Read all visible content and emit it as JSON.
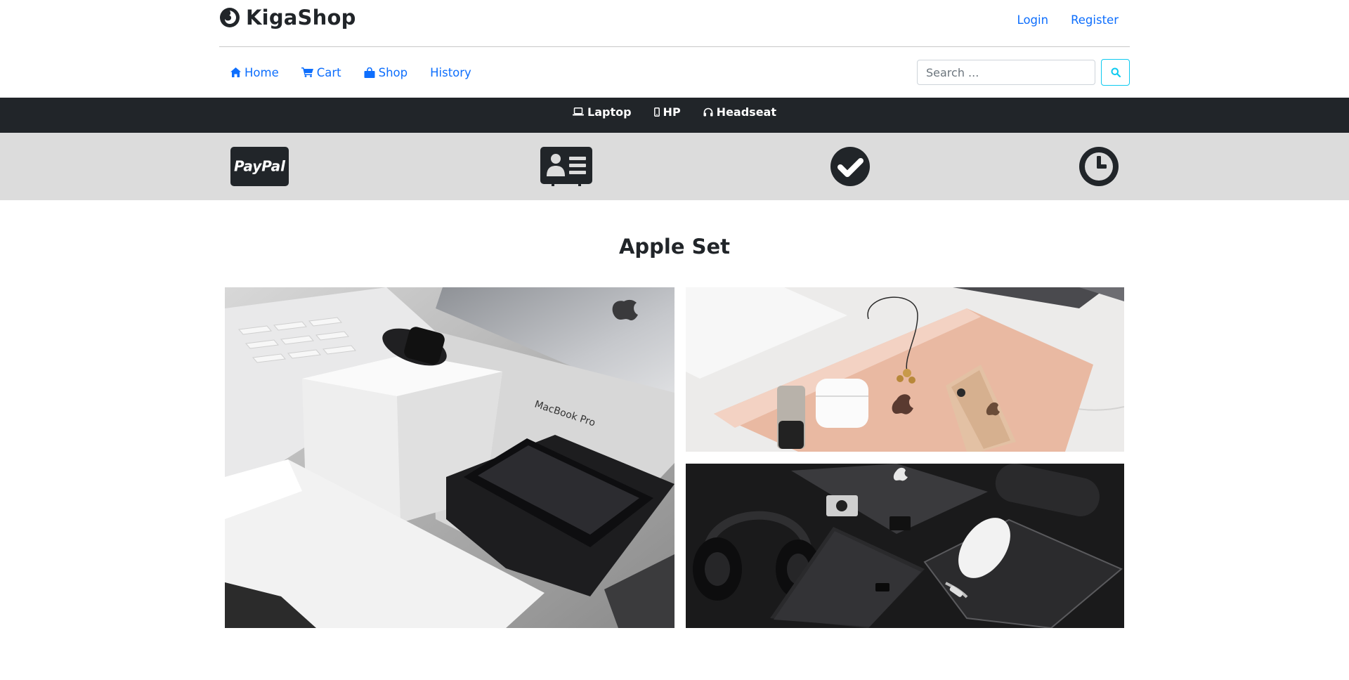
{
  "header": {
    "brand": "KigaShop",
    "login": "Login",
    "register": "Register"
  },
  "nav": {
    "items": [
      {
        "label": "Home",
        "icon": "home-icon"
      },
      {
        "label": "Cart",
        "icon": "cart-icon"
      },
      {
        "label": "Shop",
        "icon": "shopping-bag-icon"
      },
      {
        "label": "History",
        "icon": ""
      }
    ],
    "search_placeholder": "Search ...",
    "search_icon": "search-icon"
  },
  "categories": [
    {
      "label": "Laptop",
      "icon": "laptop-icon"
    },
    {
      "label": "HP",
      "icon": "mobile-icon"
    },
    {
      "label": "Headseat",
      "icon": "headphones-icon"
    }
  ],
  "features": [
    {
      "icon": "paypal-icon",
      "text": "PayPal"
    },
    {
      "icon": "id-card-icon"
    },
    {
      "icon": "check-circle-icon"
    },
    {
      "icon": "clock-icon"
    }
  ],
  "main": {
    "title": "Apple Set",
    "macbook_label": "MacBook Pro"
  },
  "colors": {
    "link": "#0d6efd",
    "dark_bar": "#212529",
    "feature_band": "#dcdcdc",
    "search_button_border": "#0dcaf0"
  }
}
